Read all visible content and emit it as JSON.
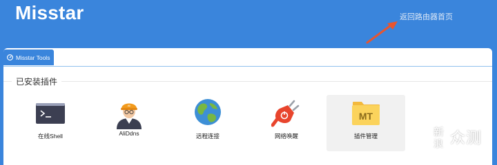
{
  "app_title": "Misstar",
  "header_link": "返回路由器首页",
  "tab_label": "Misstar Tools",
  "section_title": "已安装插件",
  "plugins": [
    {
      "label": "在线Shell",
      "icon": "terminal-icon"
    },
    {
      "label": "AliDdns",
      "icon": "worker-avatar-icon"
    },
    {
      "label": "远程连接",
      "icon": "globe-icon"
    },
    {
      "label": "网络唤醒",
      "icon": "power-plug-icon"
    },
    {
      "label": "插件管理",
      "icon": "folder-mt-icon",
      "folder_text": "MT",
      "selected": true
    }
  ],
  "avatar_badge": "Ali",
  "watermark": {
    "line1": "新",
    "line2": "值",
    "line3": "什么",
    "line4": "得",
    "text": "值 什么值得买"
  },
  "colors": {
    "header_bg": "#3a85dc",
    "tab_bg": "#3a85dc",
    "arrow": "#e8552f",
    "selected_bg": "#f1f1f1"
  }
}
